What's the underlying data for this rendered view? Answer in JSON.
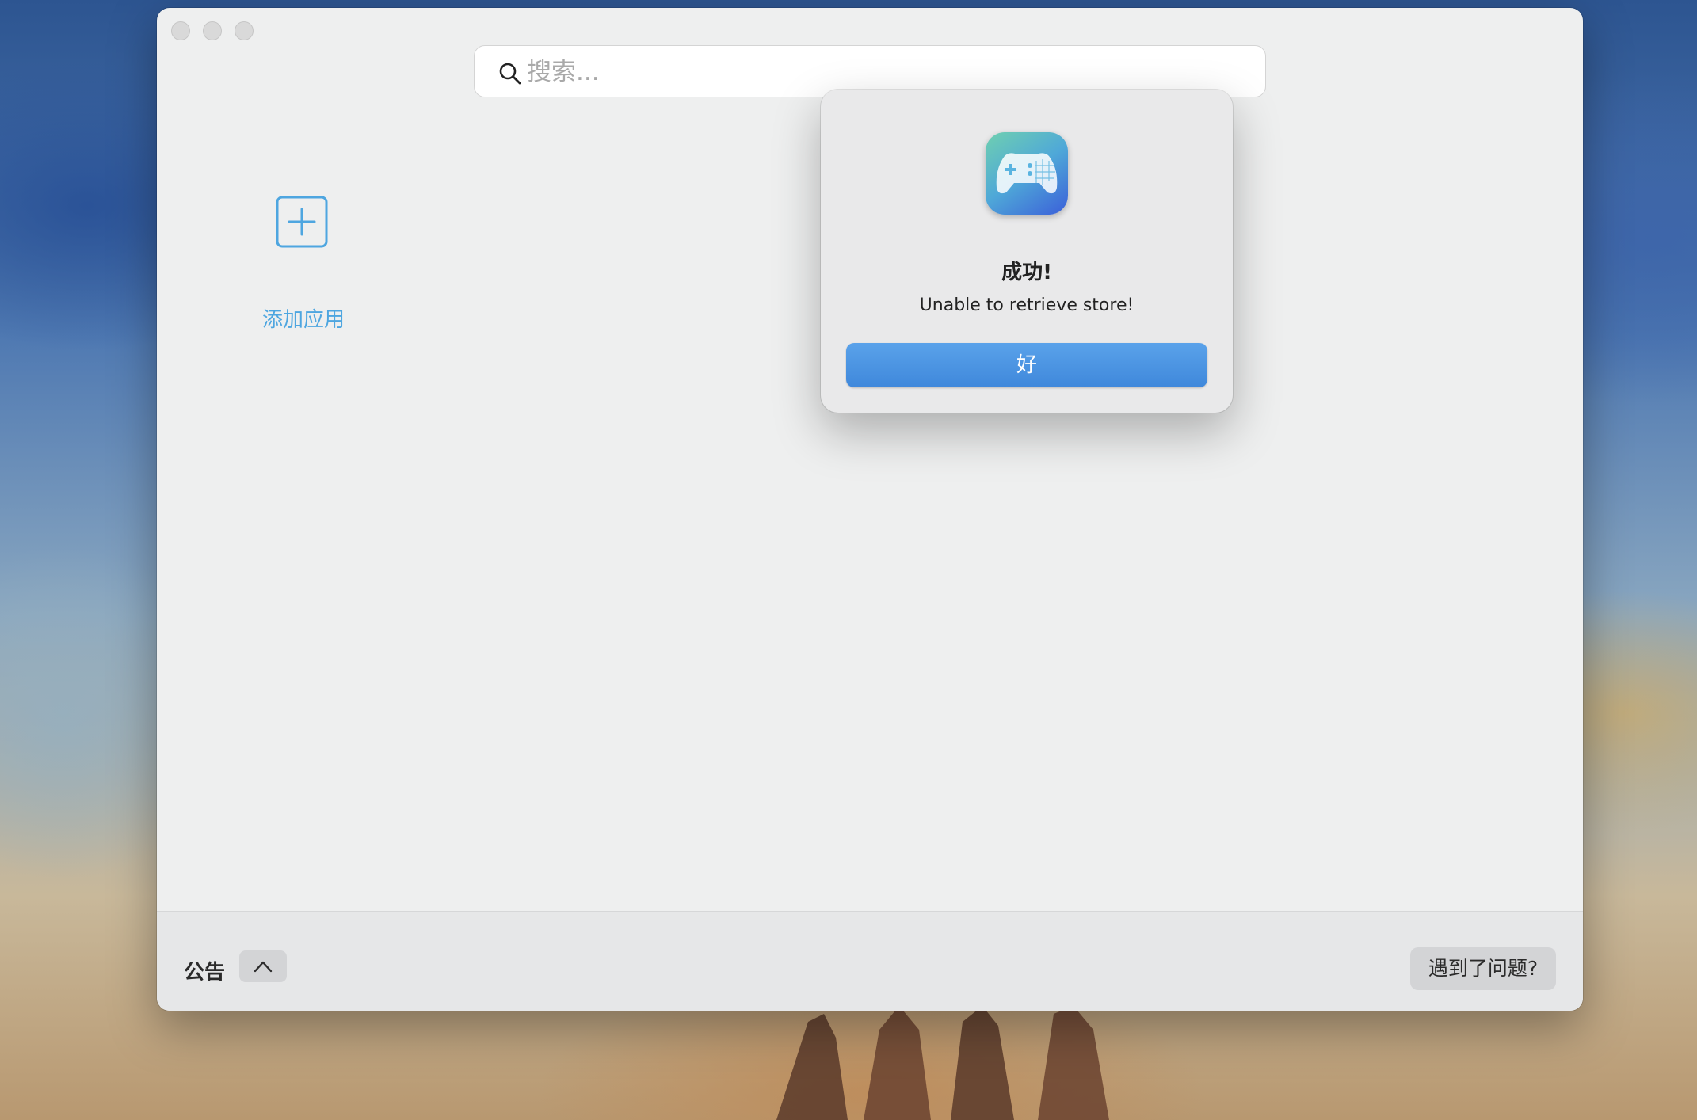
{
  "search": {
    "placeholder": "搜索..."
  },
  "main": {
    "add_app_label": "添加应用"
  },
  "footer": {
    "notice_label": "公告",
    "help_label": "遇到了问题?"
  },
  "dialog": {
    "title": "成功!",
    "message": "Unable to retrieve store!",
    "ok_label": "好"
  },
  "colors": {
    "accent": "#4ea6e0",
    "button_primary": "#4a92e2",
    "window_bg": "#eeefef"
  },
  "icons": {
    "search": "magnifier-icon",
    "add": "plus-square-icon",
    "collapse": "chevron-up-icon",
    "app": "gamepad-icon"
  }
}
